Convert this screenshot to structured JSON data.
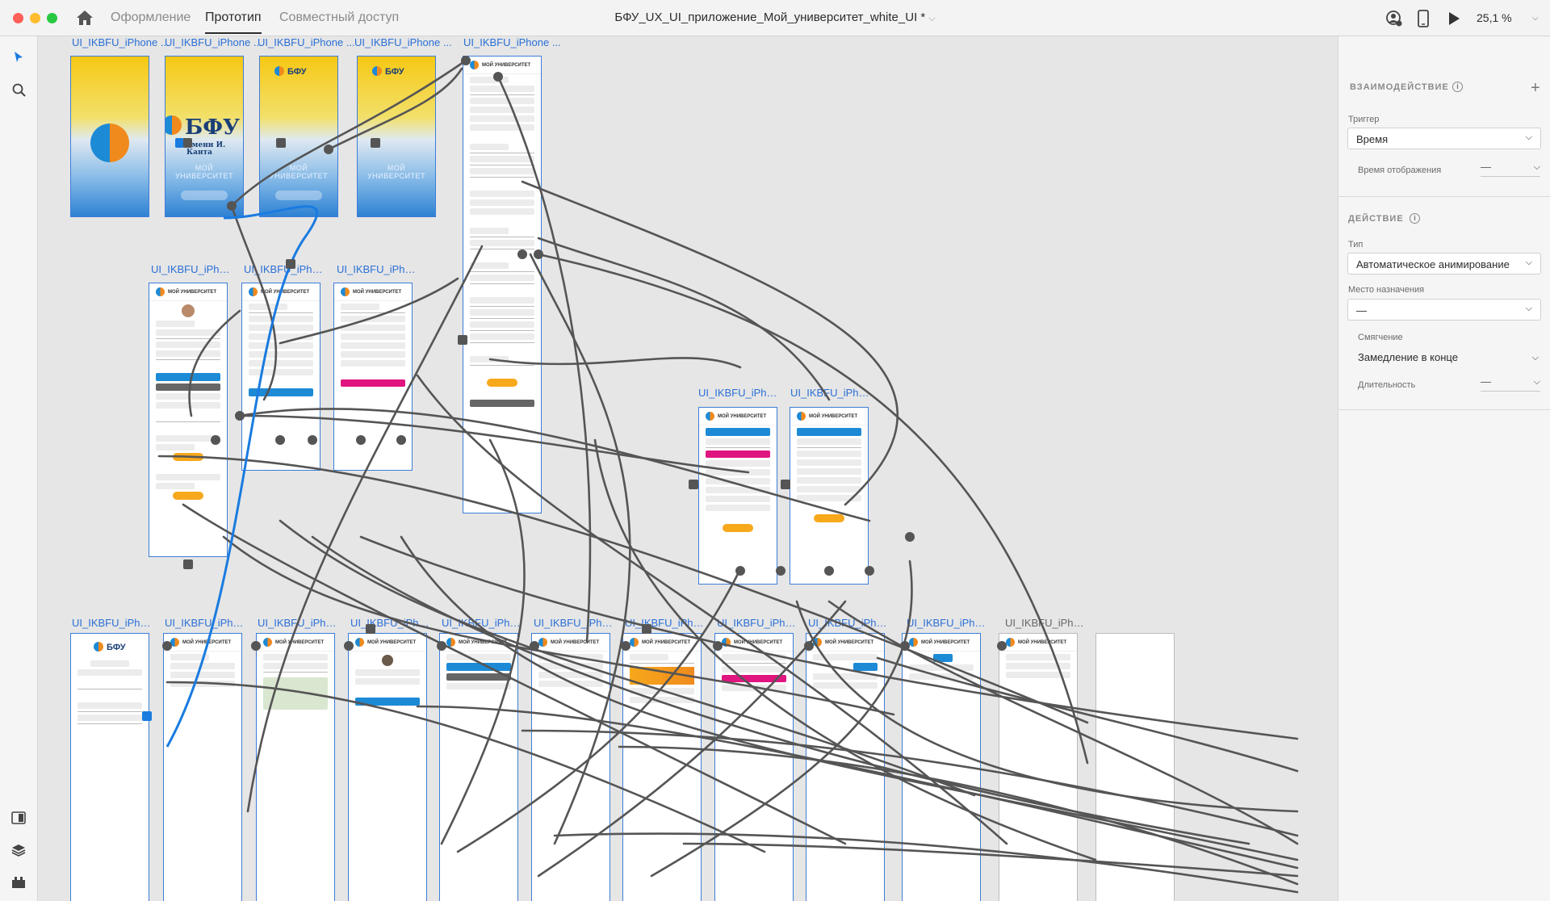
{
  "window": {
    "title": "БФУ_UX_UI_приложение_Мой_университет_white_UI *",
    "modes": [
      "Оформление",
      "Прототип",
      "Совместный доступ"
    ],
    "active_mode": "Прототип",
    "zoom": "25,1 %"
  },
  "artboards": {
    "label": "UI_IKBFU_iPhone ...",
    "labels_row3": [
      "UI_IKBFU_iPhone ...",
      "UI_IKBFU_iPhone ...",
      "UI_IKBFU_iPhone ...",
      "UI_IKBFU_iPhone ...",
      "UI_IKBFU_iPhone ...",
      "UI_IKBFU_iPhone ...",
      "UI_IKBFU_iPhone ...",
      "UI_IKBFU_iPhone ...",
      "UI_IKBFU_iPhone ...",
      "UI_IKBFU_iPhone ...",
      "UI_IKBFU_iPhone ..."
    ],
    "splash_caption": "МОЙ УНИВЕРСИТЕТ",
    "brand": "БФУ",
    "brand_sub": "имени И. Канта",
    "app_header": "МОЙ УНИВЕРСИТЕТ"
  },
  "panel": {
    "interaction_title": "ВЗАИМОДЕЙСТВИЕ",
    "trigger_label": "Триггер",
    "trigger_value": "Время",
    "display_time_label": "Время отображения",
    "display_time_value": "—",
    "action_title": "ДЕЙСТВИЕ",
    "type_label": "Тип",
    "type_value": "Автоматическое анимирование",
    "destination_label": "Место назначения",
    "destination_value": "—",
    "easing_label": "Смягчение",
    "easing_value": "Замедление в конце",
    "duration_label": "Длительность",
    "duration_value": "—"
  },
  "colors": {
    "accent_blue": "#1d8ad6",
    "wire_grey": "#555555",
    "selected_wire": "#1a7be0",
    "brand_orange": "#f7a81b",
    "brand_pink": "#e0157f"
  }
}
